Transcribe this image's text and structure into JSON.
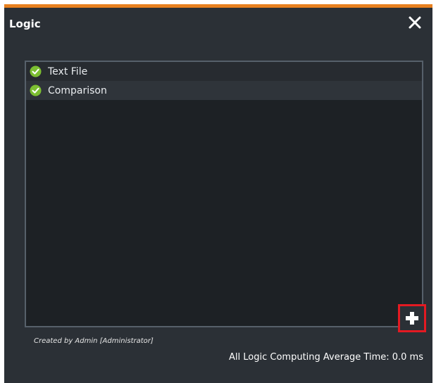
{
  "dialog": {
    "title": "Logic",
    "close_icon": "close-icon",
    "accent_color": "#e8801f"
  },
  "logic_list": {
    "items": [
      {
        "label": "Text File",
        "status": "ok",
        "icon": "check-circle-icon"
      },
      {
        "label": "Comparison",
        "status": "ok",
        "icon": "check-circle-icon"
      }
    ]
  },
  "add_button": {
    "icon": "plus-icon",
    "highlight_color": "#e31a22"
  },
  "footer": {
    "created_by": "Created by Admin [Administrator]",
    "average_time": "All Logic Computing Average Time: 0.0 ms"
  }
}
